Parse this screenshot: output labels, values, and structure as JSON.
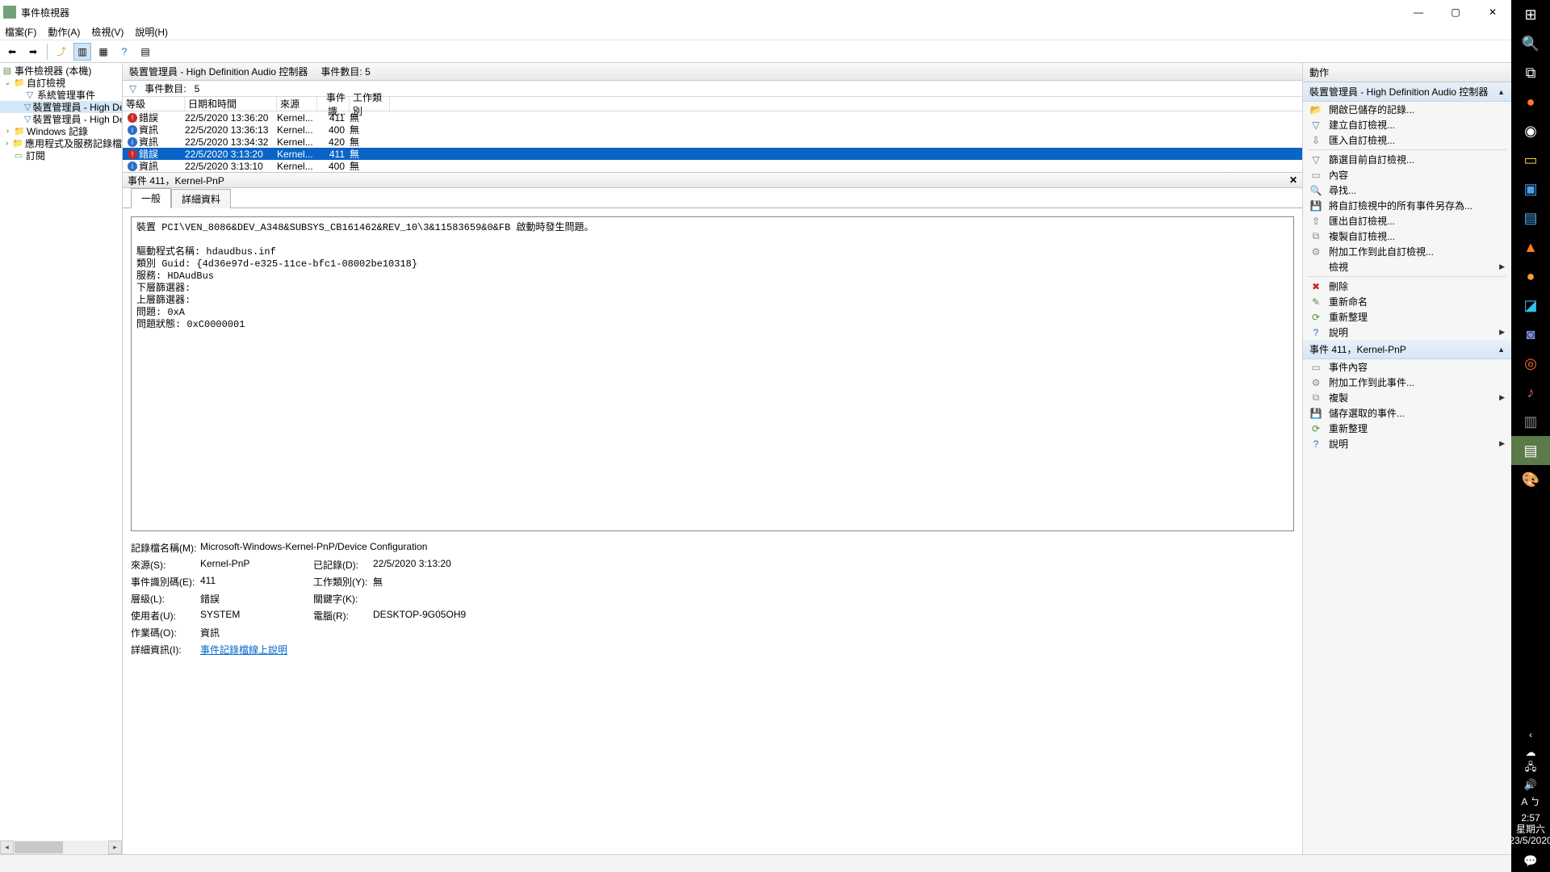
{
  "window": {
    "title": "事件檢視器",
    "min": "—",
    "max": "▢",
    "close": "✕"
  },
  "menus": {
    "file": "檔案(F)",
    "action": "動作(A)",
    "view": "檢視(V)",
    "help": "說明(H)"
  },
  "toolbar_icons": {
    "back": "⬅",
    "fwd": "➡",
    "up": "⤴",
    "c1": "▥",
    "c2": "▦",
    "c3": "?",
    "c4": "▤"
  },
  "tree": {
    "root": "事件檢視器 (本機)",
    "custom": "自訂檢視",
    "syslogs": "系統管理事件",
    "dm1": "裝置管理員 - High Defin",
    "dm2": "裝置管理員 - High Defin",
    "winlogs": "Windows 記錄",
    "appsvcs": "應用程式及服務記錄檔",
    "subs": "訂閱"
  },
  "center": {
    "hdr_title": "裝置管理員 - High Definition Audio 控制器",
    "hdr_count_label": "事件數目: 5",
    "filter_label": "事件數目:",
    "filter_count": "5",
    "cols": {
      "level": "等級",
      "datetime": "日期和時間",
      "source": "來源",
      "eventid": "事件識...",
      "task": "工作類別"
    },
    "rows": [
      {
        "lvl": "錯誤",
        "kind": "err",
        "dt": "22/5/2020 13:36:20",
        "src": "Kernel...",
        "id": "411",
        "tc": "無"
      },
      {
        "lvl": "資訊",
        "kind": "info",
        "dt": "22/5/2020 13:36:13",
        "src": "Kernel...",
        "id": "400",
        "tc": "無"
      },
      {
        "lvl": "資訊",
        "kind": "info",
        "dt": "22/5/2020 13:34:32",
        "src": "Kernel...",
        "id": "420",
        "tc": "無"
      },
      {
        "lvl": "錯誤",
        "kind": "err",
        "dt": "22/5/2020 3:13:20",
        "src": "Kernel...",
        "id": "411",
        "tc": "無",
        "sel": true
      },
      {
        "lvl": "資訊",
        "kind": "info",
        "dt": "22/5/2020 3:13:10",
        "src": "Kernel...",
        "id": "400",
        "tc": "無"
      }
    ]
  },
  "detail": {
    "title": "事件 411，Kernel-PnP",
    "tab_general": "一般",
    "tab_details": "詳細資料",
    "desc": "裝置 PCI\\VEN_8086&DEV_A348&SUBSYS_CB161462&REV_10\\3&11583659&0&FB 啟動時發生問題。\n\n驅動程式名稱: hdaudbus.inf\n類別 Guid: {4d36e97d-e325-11ce-bfc1-08002be10318}\n服務: HDAudBus\n下層篩選器:\n上層篩選器:\n問題: 0xA\n問題狀態: 0xC0000001",
    "meta": {
      "log_name_l": "記錄檔名稱(M):",
      "log_name_v": "Microsoft-Windows-Kernel-PnP/Device Configuration",
      "source_l": "來源(S):",
      "source_v": "Kernel-PnP",
      "logged_l": "已記錄(D):",
      "logged_v": "22/5/2020 3:13:20",
      "eventid_l": "事件識別碼(E):",
      "eventid_v": "411",
      "taskcat_l": "工作類別(Y):",
      "taskcat_v": "無",
      "level_l": "層級(L):",
      "level_v": "錯誤",
      "keywords_l": "關鍵字(K):",
      "keywords_v": "",
      "user_l": "使用者(U):",
      "user_v": "SYSTEM",
      "computer_l": "電腦(R):",
      "computer_v": "DESKTOP-9G05OH9",
      "opcode_l": "作業碼(O):",
      "opcode_v": "資訊",
      "moreinfo_l": "詳細資訊(I):",
      "moreinfo_link": "事件記錄檔線上說明"
    }
  },
  "actions": {
    "hdr": "動作",
    "sec1": "裝置管理員 - High Definition Audio 控制器",
    "s1": {
      "open_saved": "開啟已儲存的記錄...",
      "create_view": "建立自訂檢視...",
      "import_view": "匯入自訂檢視...",
      "filter_view": "篩選目前自訂檢視...",
      "properties": "內容",
      "find": "尋找...",
      "save_all": "將自訂檢視中的所有事件另存為...",
      "export_view": "匯出自訂檢視...",
      "copy_view": "複製自訂檢視...",
      "attach_task": "附加工作到此自訂檢視...",
      "view": "檢視",
      "delete": "刪除",
      "rename": "重新命名",
      "refresh": "重新整理",
      "help": "說明"
    },
    "sec2": "事件 411，Kernel-PnP",
    "s2": {
      "evt_props": "事件內容",
      "attach_task_evt": "附加工作到此事件...",
      "copy": "複製",
      "save_selected": "儲存選取的事件...",
      "refresh": "重新整理",
      "help": "說明"
    }
  },
  "taskbar": {
    "time": "2:57",
    "day": "星期六",
    "date": "23/5/2020"
  }
}
